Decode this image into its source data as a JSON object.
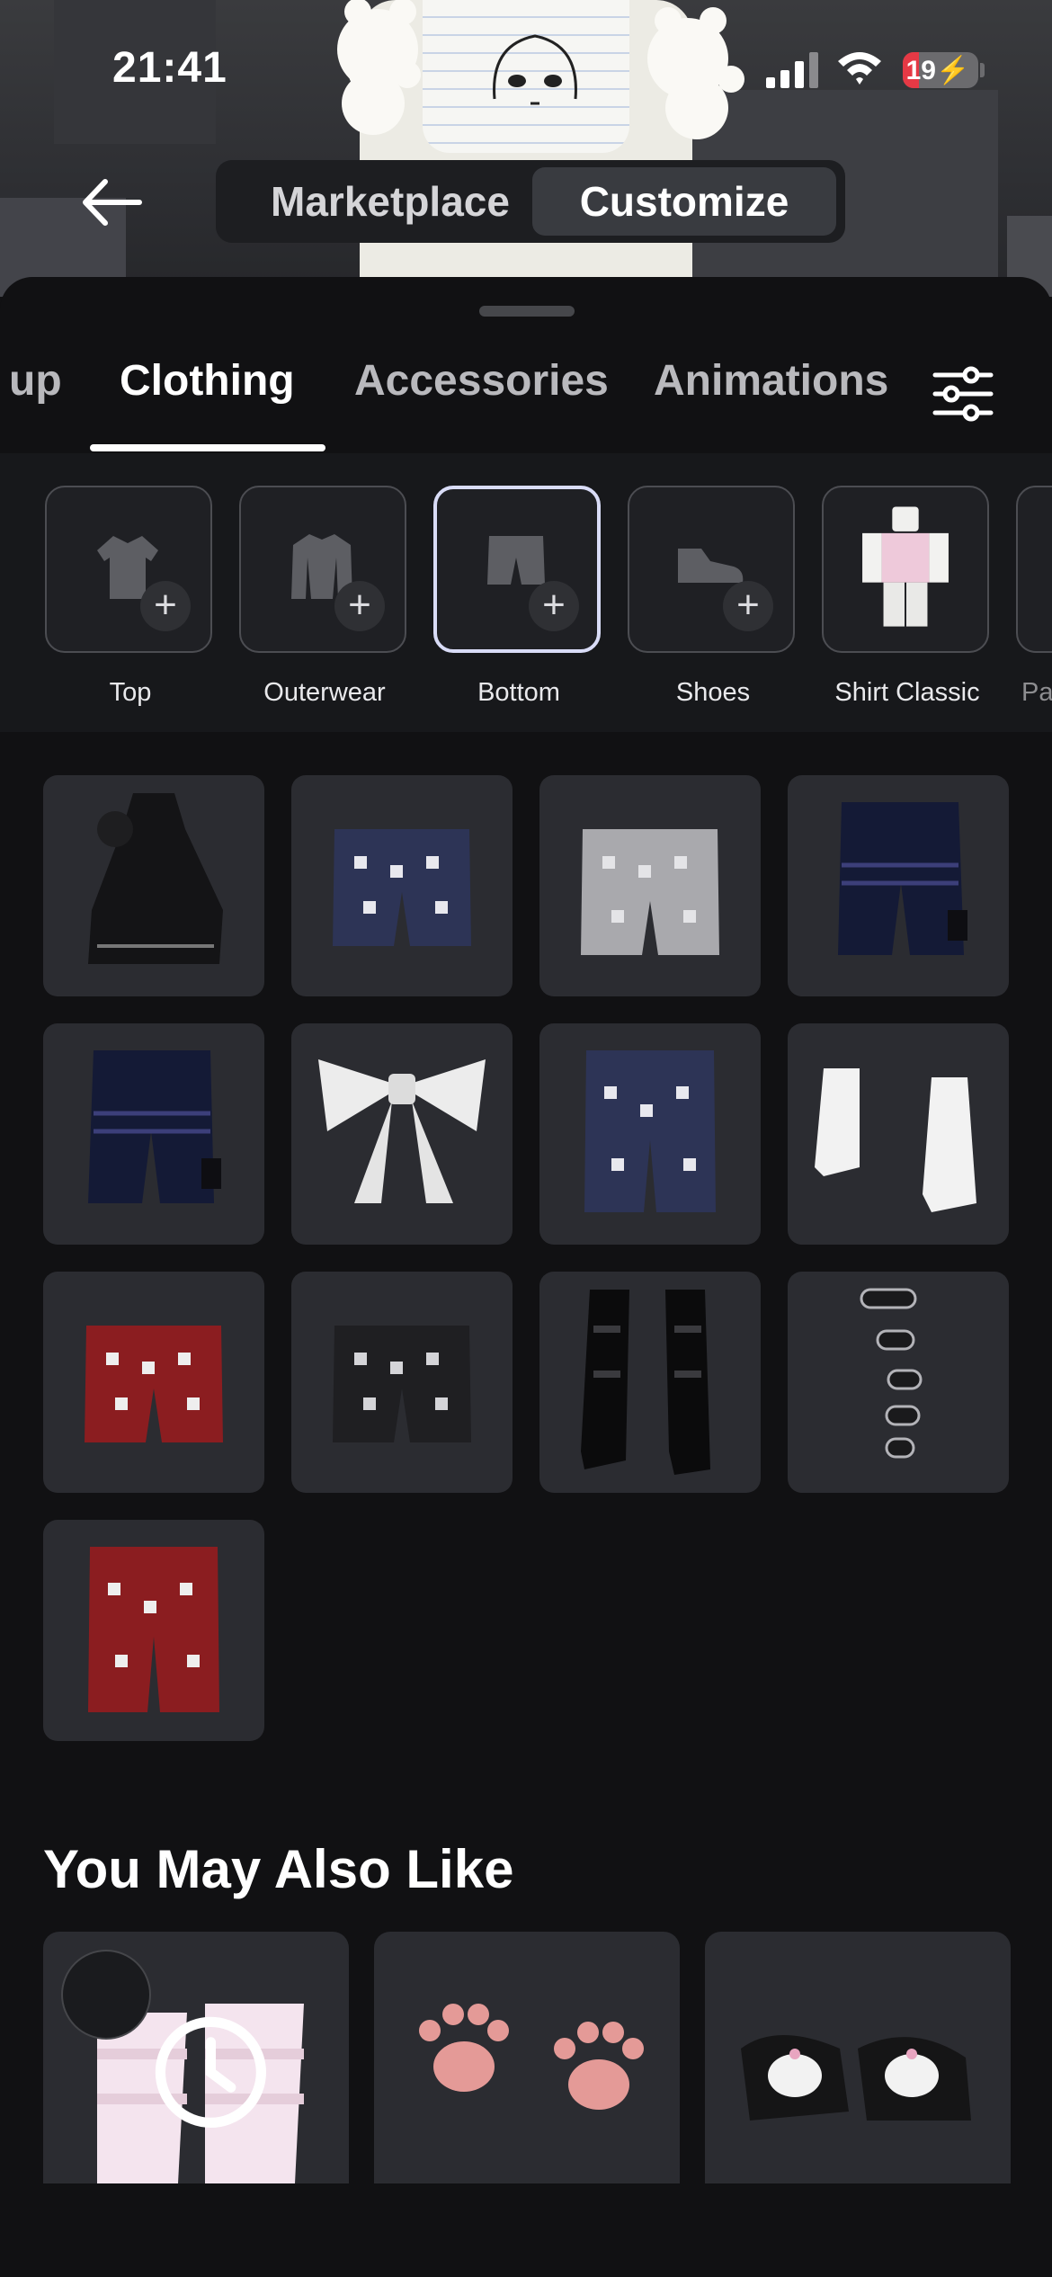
{
  "status_bar": {
    "time": "21:41",
    "battery": "19",
    "battery_level": 0.19
  },
  "header": {
    "tabs": [
      {
        "label": "Marketplace",
        "active": false
      },
      {
        "label": "Customize",
        "active": true
      }
    ]
  },
  "category_tabs": [
    {
      "label": "up",
      "active": false
    },
    {
      "label": "Clothing",
      "active": true
    },
    {
      "label": "Accessories",
      "active": false
    },
    {
      "label": "Animations",
      "active": false
    }
  ],
  "subcategories": [
    {
      "label": "Top",
      "icon": "shirt-icon",
      "selected": false
    },
    {
      "label": "Outerwear",
      "icon": "jacket-icon",
      "selected": false
    },
    {
      "label": "Bottom",
      "icon": "pants-icon",
      "selected": true
    },
    {
      "label": "Shoes",
      "icon": "sneaker-icon",
      "selected": false
    },
    {
      "label": "Shirt Classic",
      "icon": "classic-shirt-thumbnail",
      "selected": false
    },
    {
      "label": "Pa",
      "icon": "classic-pants-thumbnail",
      "selected": false
    }
  ],
  "items": [
    "black-dress",
    "navy-patterned-shorts",
    "grey-patterned-shorts",
    "navy-cargo-shorts",
    "navy-cargo-shorts",
    "white-bow",
    "navy-patterned-shorts",
    "white-boots",
    "red-patterned-shorts",
    "black-patterned-shorts",
    "black-platform-boots",
    "studded-bracelets",
    "red-patterned-shorts"
  ],
  "you_may_also_like": {
    "title": "You May Also Like",
    "items": [
      "pink-ruffle-leg-warmers",
      "pink-paw-prints",
      "kuromi-slippers"
    ]
  },
  "colors": {
    "accent": "#d9dcf7",
    "background": "#111113",
    "tile": "#2b2c31"
  }
}
